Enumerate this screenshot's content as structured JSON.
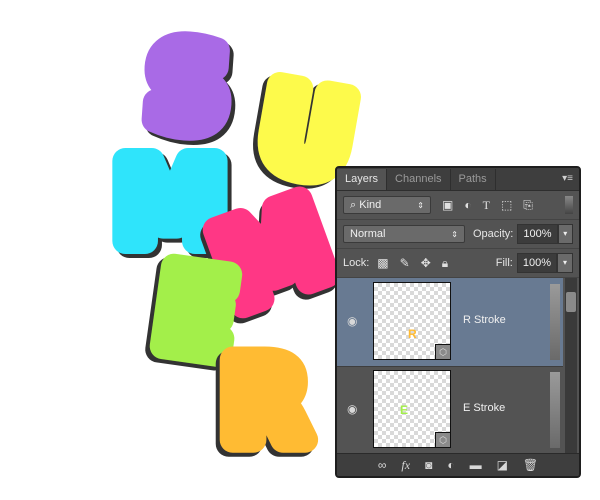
{
  "artwork": {
    "word": "SUMMER",
    "letters": [
      {
        "char": "S",
        "color": "#a96ae6"
      },
      {
        "char": "U",
        "color": "#fdfa4b"
      },
      {
        "char": "M",
        "color": "#2fe4fb"
      },
      {
        "char": "M",
        "color": "#ff3785"
      },
      {
        "char": "E",
        "color": "#a3ef4a"
      },
      {
        "char": "R",
        "color": "#ffbb33"
      }
    ]
  },
  "panel": {
    "tabs": [
      {
        "label": "Layers",
        "active": true
      },
      {
        "label": "Channels",
        "active": false
      },
      {
        "label": "Paths",
        "active": false
      }
    ],
    "menu_icon": "panel-menu-icon",
    "filter": {
      "label": "Kind",
      "icon": "search-icon"
    },
    "filter_icons": [
      "pixel-filter-icon",
      "adjustment-filter-icon",
      "type-filter-icon",
      "shape-filter-icon",
      "smart-object-filter-icon"
    ],
    "blend_mode": "Normal",
    "opacity_label": "Opacity:",
    "opacity_value": "100%",
    "lock_label": "Lock:",
    "lock_icons": [
      "lock-transparent-icon",
      "lock-paint-icon",
      "lock-position-icon",
      "lock-all-icon"
    ],
    "fill_label": "Fill:",
    "fill_value": "100%",
    "layers": [
      {
        "name": "R Stroke",
        "selected": true,
        "visible": true,
        "thumb_char": "R",
        "thumb_color": "#ffbb33"
      },
      {
        "name": "E Stroke",
        "selected": false,
        "visible": true,
        "thumb_char": "E",
        "thumb_color": "#a3ef4a"
      }
    ],
    "bottom_icons": [
      "link-layers-icon",
      "fx-icon",
      "add-mask-icon",
      "adjustment-layer-icon",
      "new-group-icon",
      "new-layer-icon",
      "trash-icon"
    ]
  }
}
